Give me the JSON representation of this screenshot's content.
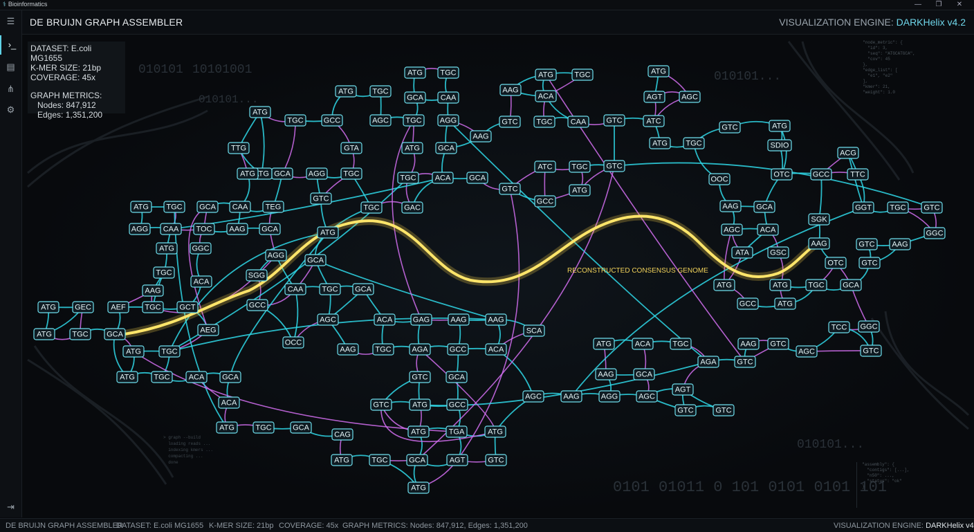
{
  "window": {
    "title": "Bioinformatics",
    "minimize": "—",
    "restore": "❐",
    "close": "✕"
  },
  "header": {
    "title": "DE BRUIJN GRAPH ASSEMBLER",
    "engine_label": "VISUALIZATION ENGINE:",
    "engine_value": "DARKHelix v4.2"
  },
  "sidebar": {
    "items": [
      "terminal-icon",
      "dataset-icon",
      "graph-icon",
      "settings-icon"
    ],
    "bottom": "exit-icon"
  },
  "info": {
    "dataset": "DATASET: E.coli MG1655",
    "kmer": "K-MER SIZE: 21bp",
    "coverage": "COVERAGE: 45x",
    "metrics_title": "GRAPH METRICS:",
    "nodes": "Nodes: 847,912",
    "edges": "Edges: 1,351,200"
  },
  "graph": {
    "consensus_label": "RECONSTRUCTED CONSENSUS GENOME",
    "binary_strings": [
      "010101",
      "10101001",
      "010101...",
      "010101...",
      "010101...",
      "0101 01011 0 101 0101 0101 101"
    ],
    "nodes": [
      [
        "ATG",
        378,
        251
      ],
      [
        "TGC",
        427,
        174
      ],
      [
        "GCC",
        480,
        174
      ],
      [
        "AGC",
        550,
        174
      ],
      [
        "TGC",
        598,
        174
      ],
      [
        "AGG",
        648,
        174
      ],
      [
        "ATG",
        500,
        132
      ],
      [
        "TGC",
        550,
        132
      ],
      [
        "GCA",
        600,
        141
      ],
      [
        "ATG",
        600,
        105
      ],
      [
        "TGC",
        648,
        105
      ],
      [
        "CAA",
        648,
        141
      ],
      [
        "AAG",
        738,
        130
      ],
      [
        "ACA",
        789,
        139
      ],
      [
        "ATG",
        789,
        108
      ],
      [
        "TGC",
        842,
        108
      ],
      [
        "ATG",
        952,
        103
      ],
      [
        "AGT",
        946,
        140
      ],
      [
        "AGC",
        997,
        140
      ],
      [
        "ATG",
        376,
        162
      ],
      [
        "TTG",
        345,
        214
      ],
      [
        "ATG",
        358,
        251
      ],
      [
        "GCA",
        408,
        251
      ],
      [
        "AGG",
        458,
        251
      ],
      [
        "GTA",
        508,
        214
      ],
      [
        "TGC",
        508,
        251
      ],
      [
        "GTC",
        737,
        176
      ],
      [
        "TGC",
        787,
        176
      ],
      [
        "CAA",
        836,
        176
      ],
      [
        "GTC",
        888,
        174
      ],
      [
        "ATC",
        945,
        175
      ],
      [
        "GTC",
        1055,
        184
      ],
      [
        "ATG",
        1127,
        182
      ],
      [
        "ATG",
        596,
        214
      ],
      [
        "GCA",
        645,
        214
      ],
      [
        "AAG",
        695,
        197
      ],
      [
        "ATG",
        954,
        207
      ],
      [
        "TGC",
        1003,
        207
      ],
      [
        "SDIO",
        1127,
        210
      ],
      [
        "ACG",
        1226,
        221
      ],
      [
        "TGC",
        590,
        257
      ],
      [
        "ACA",
        640,
        257
      ],
      [
        "GCA",
        690,
        257
      ],
      [
        "ATC",
        788,
        241
      ],
      [
        "TGC",
        838,
        241
      ],
      [
        "GTC",
        888,
        240
      ],
      [
        "GTC",
        737,
        273
      ],
      [
        "ATG",
        838,
        275
      ],
      [
        "GCC",
        788,
        291
      ],
      [
        "GTC",
        464,
        287
      ],
      [
        "TGC",
        537,
        300
      ],
      [
        "GAC",
        596,
        300
      ],
      [
        "OTC",
        1130,
        252
      ],
      [
        "GCC",
        1187,
        252
      ],
      [
        "TTC",
        1240,
        252
      ],
      [
        "OOC",
        1040,
        259
      ],
      [
        "ATG",
        204,
        299
      ],
      [
        "TGC",
        252,
        299
      ],
      [
        "GCA",
        300,
        299
      ],
      [
        "CAA",
        347,
        299
      ],
      [
        "TEG",
        395,
        299
      ],
      [
        "AGG",
        202,
        331
      ],
      [
        "CAA",
        247,
        331
      ],
      [
        "TOC",
        295,
        331
      ],
      [
        "AAG",
        343,
        331
      ],
      [
        "GCA",
        390,
        331
      ],
      [
        "ATG",
        241,
        359
      ],
      [
        "GGC",
        290,
        359
      ],
      [
        "AGG",
        399,
        369
      ],
      [
        "ATG",
        474,
        336
      ],
      [
        "GCA",
        456,
        376
      ],
      [
        "TGC",
        237,
        394
      ],
      [
        "ACA",
        291,
        407
      ],
      [
        "AAG",
        221,
        420
      ],
      [
        "SGG",
        371,
        398
      ],
      [
        "CAA",
        427,
        418
      ],
      [
        "TGC",
        477,
        418
      ],
      [
        "GCA",
        525,
        418
      ],
      [
        "ATG",
        70,
        444
      ],
      [
        "GEC",
        120,
        444
      ],
      [
        "AEF",
        171,
        444
      ],
      [
        "TGC",
        221,
        444
      ],
      [
        "GCT",
        271,
        444
      ],
      [
        "GCC",
        372,
        441
      ],
      [
        "ATG",
        64,
        483
      ],
      [
        "TGC",
        116,
        483
      ],
      [
        "GCA",
        166,
        483
      ],
      [
        "AEG",
        301,
        477
      ],
      [
        "OCC",
        424,
        495
      ],
      [
        "ATG",
        193,
        508
      ],
      [
        "TGC",
        245,
        508
      ],
      [
        "ATG",
        184,
        545
      ],
      [
        "TGC",
        234,
        545
      ],
      [
        "ACA",
        284,
        545
      ],
      [
        "GCA",
        333,
        545
      ],
      [
        "ACA",
        331,
        582
      ],
      [
        "ATG",
        328,
        618
      ],
      [
        "TGC",
        381,
        618
      ],
      [
        "GCA",
        435,
        618
      ],
      [
        "AGC",
        474,
        462
      ],
      [
        "ACA",
        556,
        462
      ],
      [
        "GAG",
        609,
        462
      ],
      [
        "AAG",
        663,
        462
      ],
      [
        "AAG",
        717,
        462
      ],
      [
        "SCA",
        772,
        478
      ],
      [
        "AAG",
        503,
        505
      ],
      [
        "TGC",
        554,
        505
      ],
      [
        "AGA",
        607,
        505
      ],
      [
        "GCC",
        662,
        505
      ],
      [
        "ACA",
        717,
        505
      ],
      [
        "GTC",
        607,
        545
      ],
      [
        "GCA",
        660,
        545
      ],
      [
        "GTC",
        551,
        585
      ],
      [
        "ATG",
        607,
        585
      ],
      [
        "GCC",
        661,
        585
      ],
      [
        "CAG",
        495,
        628
      ],
      [
        "ATG",
        605,
        624
      ],
      [
        "TGA",
        660,
        624
      ],
      [
        "ATG",
        716,
        624
      ],
      [
        "ATG",
        494,
        665
      ],
      [
        "TGC",
        549,
        665
      ],
      [
        "GCA",
        603,
        665
      ],
      [
        "AGT",
        661,
        665
      ],
      [
        "GTC",
        717,
        665
      ],
      [
        "ATG",
        605,
        705
      ],
      [
        "AGC",
        771,
        573
      ],
      [
        "AAG",
        826,
        573
      ],
      [
        "AGG",
        881,
        573
      ],
      [
        "AGC",
        935,
        573
      ],
      [
        "AAG",
        876,
        541
      ],
      [
        "GCA",
        931,
        541
      ],
      [
        "AGT",
        987,
        563
      ],
      [
        "GTC",
        991,
        593
      ],
      [
        "GTC",
        1046,
        593
      ],
      [
        "ATG",
        873,
        497
      ],
      [
        "ACA",
        929,
        497
      ],
      [
        "TGC",
        984,
        497
      ],
      [
        "AAG",
        1056,
        298
      ],
      [
        "GCA",
        1105,
        299
      ],
      [
        "AGC",
        1058,
        332
      ],
      [
        "ACA",
        1110,
        332
      ],
      [
        "ATA",
        1073,
        365
      ],
      [
        "GSC",
        1125,
        365
      ],
      [
        "ATG",
        1047,
        412
      ],
      [
        "ATG",
        1128,
        412
      ],
      [
        "TGC",
        1180,
        412
      ],
      [
        "GCA",
        1230,
        412
      ],
      [
        "GCC",
        1081,
        439
      ],
      [
        "ATG",
        1135,
        439
      ],
      [
        "AAG",
        1082,
        497
      ],
      [
        "GTC",
        1125,
        497
      ],
      [
        "AGC",
        1166,
        508
      ],
      [
        "TCC",
        1213,
        473
      ],
      [
        "GGC",
        1256,
        472
      ],
      [
        "GTC",
        1259,
        507
      ],
      [
        "AGA",
        1024,
        523
      ],
      [
        "GTC",
        1077,
        523
      ],
      [
        "SGK",
        1184,
        317
      ],
      [
        "GGT",
        1248,
        300
      ],
      [
        "TGC",
        1298,
        300
      ],
      [
        "GTC",
        1347,
        300
      ],
      [
        "AAG",
        1184,
        352
      ],
      [
        "GTC",
        1253,
        353
      ],
      [
        "AAG",
        1301,
        353
      ],
      [
        "GGC",
        1351,
        337
      ],
      [
        "OTC",
        1208,
        380
      ],
      [
        "GTC",
        1257,
        380
      ]
    ]
  }
}
